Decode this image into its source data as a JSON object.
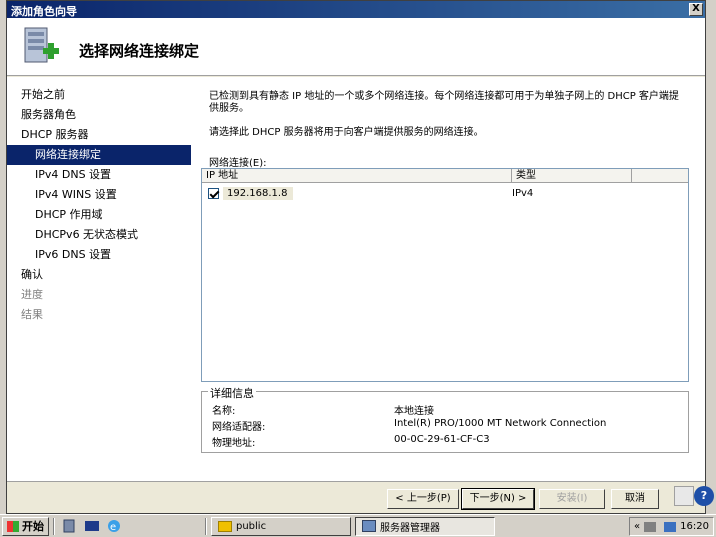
{
  "window": {
    "title": "添加角色向导",
    "close_label": "X"
  },
  "header": {
    "title": "选择网络连接绑定"
  },
  "nav": {
    "items": [
      {
        "label": "开始之前"
      },
      {
        "label": "服务器角色"
      },
      {
        "label": "DHCP 服务器"
      },
      {
        "label": "网络连接绑定"
      },
      {
        "label": "IPv4 DNS 设置"
      },
      {
        "label": "IPv4 WINS 设置"
      },
      {
        "label": "DHCP 作用域"
      },
      {
        "label": "DHCPv6 无状态模式"
      },
      {
        "label": "IPv6 DNS 设置"
      },
      {
        "label": "确认"
      },
      {
        "label": "进度"
      },
      {
        "label": "结果"
      }
    ]
  },
  "content": {
    "intro": "已检测到具有静态 IP 地址的一个或多个网络连接。每个网络连接都可用于为单独子网上的 DHCP 客户端提供服务。",
    "instruction": "请选择此 DHCP 服务器将用于向客户端提供服务的网络连接。",
    "list_label": "网络连接(E):",
    "columns": {
      "ip": "IP 地址",
      "type": "类型"
    },
    "rows": [
      {
        "ip": "192.168.1.8",
        "type": "IPv4",
        "checked": true
      }
    ]
  },
  "details": {
    "legend": "详细信息",
    "name_label": "名称:",
    "name_value": "本地连接",
    "adapter_label": "网络适配器:",
    "adapter_value": "Intel(R) PRO/1000 MT Network Connection",
    "mac_label": "物理地址:",
    "mac_value": "00-0C-29-61-CF-C3"
  },
  "footer": {
    "prev": "< 上一步(P)",
    "next": "下一步(N) >",
    "install": "安装(I)",
    "cancel": "取消"
  },
  "taskbar": {
    "start": "开始",
    "tasks": [
      {
        "label": "public"
      },
      {
        "label": "服务器管理器"
      }
    ],
    "clock": "16:20"
  },
  "help_label": "?"
}
